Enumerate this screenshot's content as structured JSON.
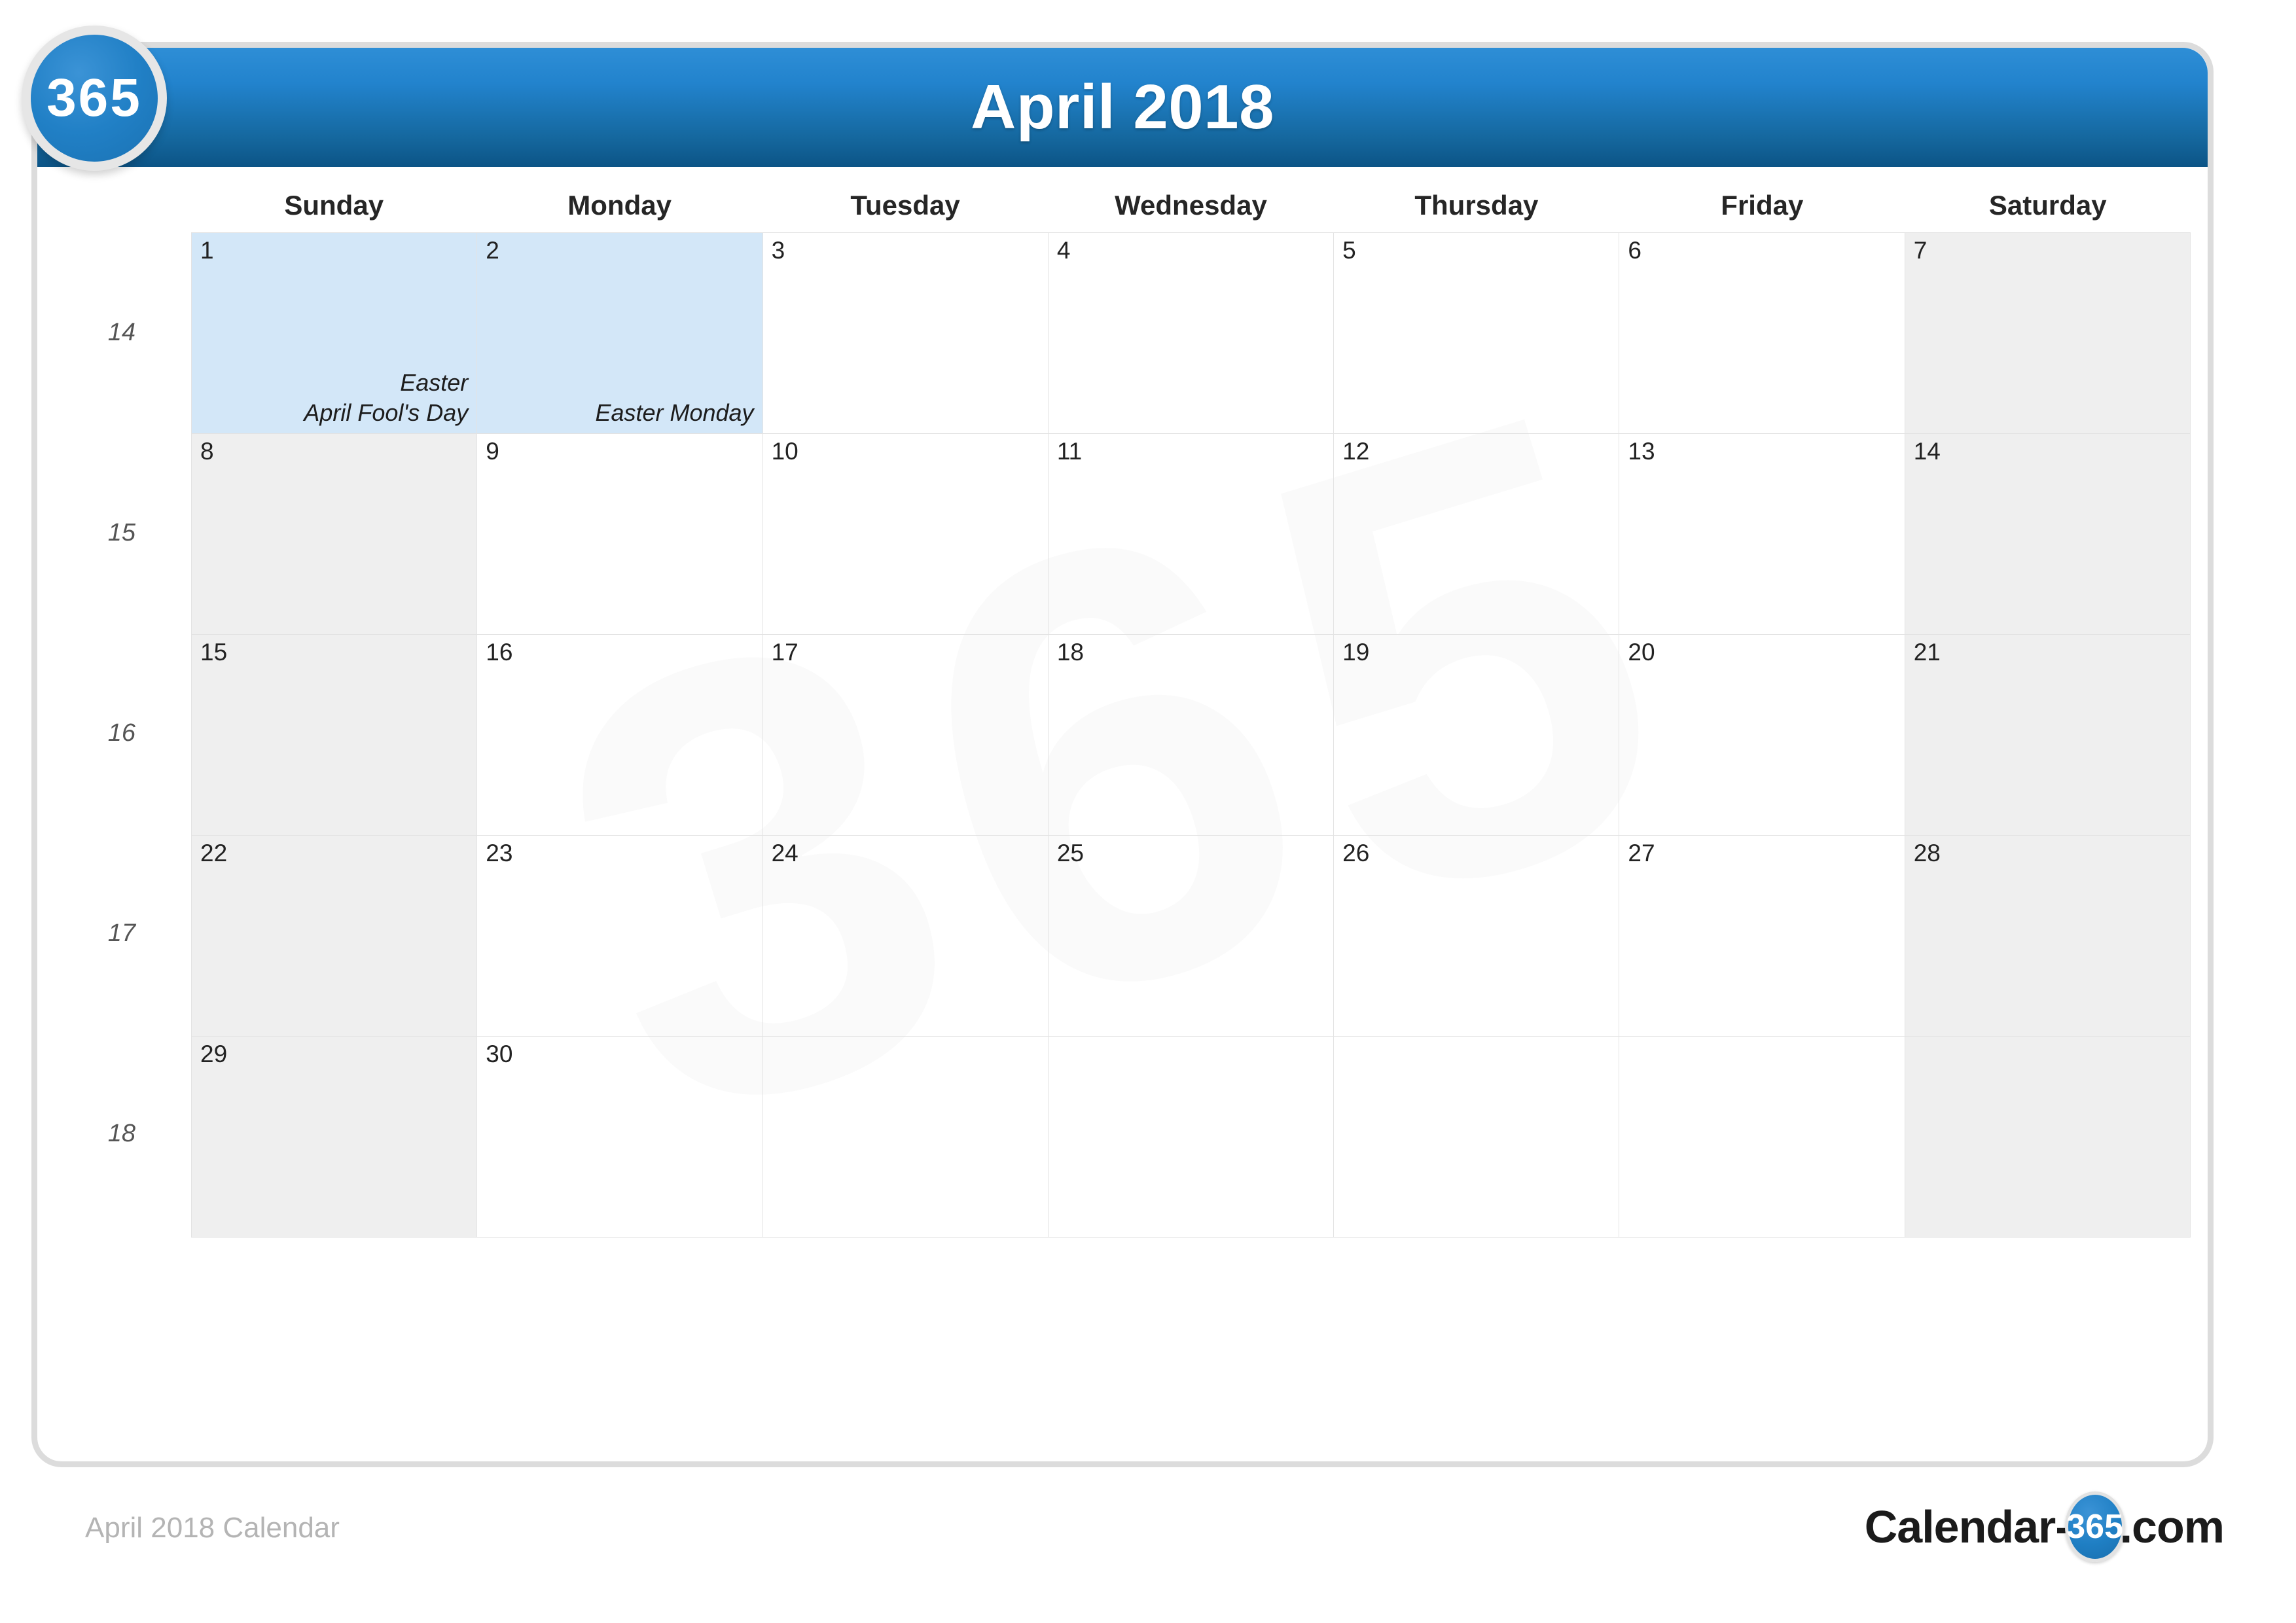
{
  "badge": {
    "text": "365"
  },
  "header": {
    "title": "April 2018"
  },
  "weekday_headers": [
    "Sunday",
    "Monday",
    "Tuesday",
    "Wednesday",
    "Thursday",
    "Friday",
    "Saturday"
  ],
  "week_numbers": [
    "14",
    "15",
    "16",
    "17",
    "18"
  ],
  "colors": {
    "header_gradient_top": "#2e8ed6",
    "header_gradient_bottom": "#0c5486",
    "weekend_cell": "#efefef",
    "highlight_cell": "#d3e7f8",
    "card_border": "#dcdcdc",
    "grid_line": "#e3e3e3",
    "badge_blue": "#2180c6",
    "footer_text": "#b4b4b4"
  },
  "weeks": [
    {
      "week_number": "14",
      "days": [
        {
          "num": "1",
          "type": "highlight",
          "events": [
            "Easter",
            "April Fool's Day"
          ]
        },
        {
          "num": "2",
          "type": "highlight",
          "events": [
            "Easter Monday"
          ]
        },
        {
          "num": "3",
          "type": "plain",
          "events": []
        },
        {
          "num": "4",
          "type": "plain",
          "events": []
        },
        {
          "num": "5",
          "type": "plain",
          "events": []
        },
        {
          "num": "6",
          "type": "plain",
          "events": []
        },
        {
          "num": "7",
          "type": "weekend",
          "events": []
        }
      ]
    },
    {
      "week_number": "15",
      "days": [
        {
          "num": "8",
          "type": "weekend",
          "events": []
        },
        {
          "num": "9",
          "type": "plain",
          "events": []
        },
        {
          "num": "10",
          "type": "plain",
          "events": []
        },
        {
          "num": "11",
          "type": "plain",
          "events": []
        },
        {
          "num": "12",
          "type": "plain",
          "events": []
        },
        {
          "num": "13",
          "type": "plain",
          "events": []
        },
        {
          "num": "14",
          "type": "weekend",
          "events": []
        }
      ]
    },
    {
      "week_number": "16",
      "days": [
        {
          "num": "15",
          "type": "weekend",
          "events": []
        },
        {
          "num": "16",
          "type": "plain",
          "events": []
        },
        {
          "num": "17",
          "type": "plain",
          "events": []
        },
        {
          "num": "18",
          "type": "plain",
          "events": []
        },
        {
          "num": "19",
          "type": "plain",
          "events": []
        },
        {
          "num": "20",
          "type": "plain",
          "events": []
        },
        {
          "num": "21",
          "type": "weekend",
          "events": []
        }
      ]
    },
    {
      "week_number": "17",
      "days": [
        {
          "num": "22",
          "type": "weekend",
          "events": []
        },
        {
          "num": "23",
          "type": "plain",
          "events": []
        },
        {
          "num": "24",
          "type": "plain",
          "events": []
        },
        {
          "num": "25",
          "type": "plain",
          "events": []
        },
        {
          "num": "26",
          "type": "plain",
          "events": []
        },
        {
          "num": "27",
          "type": "plain",
          "events": []
        },
        {
          "num": "28",
          "type": "weekend",
          "events": []
        }
      ]
    },
    {
      "week_number": "18",
      "days": [
        {
          "num": "29",
          "type": "weekend",
          "events": []
        },
        {
          "num": "30",
          "type": "plain",
          "events": []
        },
        {
          "num": "",
          "type": "plain",
          "events": []
        },
        {
          "num": "",
          "type": "plain",
          "events": []
        },
        {
          "num": "",
          "type": "plain",
          "events": []
        },
        {
          "num": "",
          "type": "plain",
          "events": []
        },
        {
          "num": "",
          "type": "weekend",
          "events": []
        }
      ]
    }
  ],
  "watermark": {
    "text": "365"
  },
  "footer": {
    "left_label": "April 2018 Calendar",
    "logo_prefix": "Calendar-",
    "logo_badge": "365",
    "logo_suffix": ".com"
  }
}
